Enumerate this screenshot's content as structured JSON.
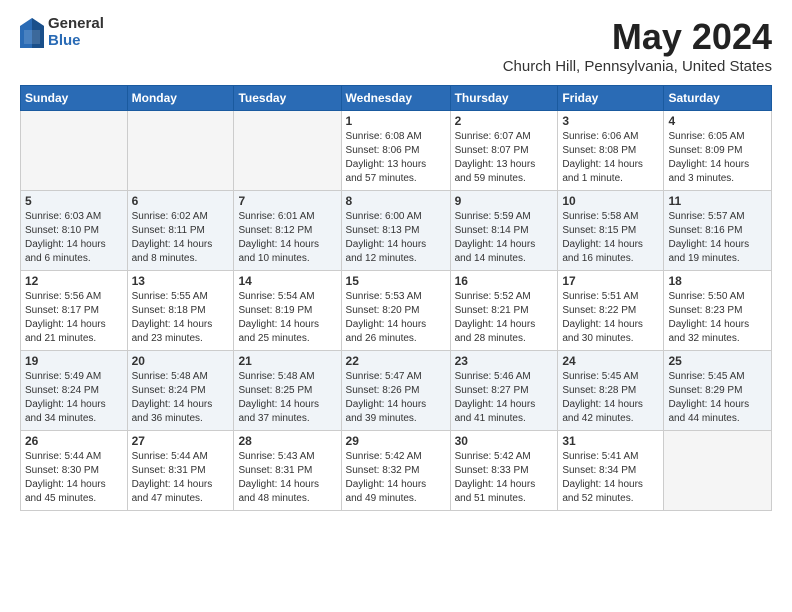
{
  "logo": {
    "general": "General",
    "blue": "Blue",
    "icon_title": "GeneralBlue logo"
  },
  "title": "May 2024",
  "location": "Church Hill, Pennsylvania, United States",
  "days_of_week": [
    "Sunday",
    "Monday",
    "Tuesday",
    "Wednesday",
    "Thursday",
    "Friday",
    "Saturday"
  ],
  "weeks": [
    [
      {
        "day": "",
        "empty": true
      },
      {
        "day": "",
        "empty": true
      },
      {
        "day": "",
        "empty": true
      },
      {
        "day": "1",
        "sunrise": "6:08 AM",
        "sunset": "8:06 PM",
        "daylight": "13 hours and 57 minutes."
      },
      {
        "day": "2",
        "sunrise": "6:07 AM",
        "sunset": "8:07 PM",
        "daylight": "13 hours and 59 minutes."
      },
      {
        "day": "3",
        "sunrise": "6:06 AM",
        "sunset": "8:08 PM",
        "daylight": "14 hours and 1 minute."
      },
      {
        "day": "4",
        "sunrise": "6:05 AM",
        "sunset": "8:09 PM",
        "daylight": "14 hours and 3 minutes."
      }
    ],
    [
      {
        "day": "5",
        "sunrise": "6:03 AM",
        "sunset": "8:10 PM",
        "daylight": "14 hours and 6 minutes."
      },
      {
        "day": "6",
        "sunrise": "6:02 AM",
        "sunset": "8:11 PM",
        "daylight": "14 hours and 8 minutes."
      },
      {
        "day": "7",
        "sunrise": "6:01 AM",
        "sunset": "8:12 PM",
        "daylight": "14 hours and 10 minutes."
      },
      {
        "day": "8",
        "sunrise": "6:00 AM",
        "sunset": "8:13 PM",
        "daylight": "14 hours and 12 minutes."
      },
      {
        "day": "9",
        "sunrise": "5:59 AM",
        "sunset": "8:14 PM",
        "daylight": "14 hours and 14 minutes."
      },
      {
        "day": "10",
        "sunrise": "5:58 AM",
        "sunset": "8:15 PM",
        "daylight": "14 hours and 16 minutes."
      },
      {
        "day": "11",
        "sunrise": "5:57 AM",
        "sunset": "8:16 PM",
        "daylight": "14 hours and 19 minutes."
      }
    ],
    [
      {
        "day": "12",
        "sunrise": "5:56 AM",
        "sunset": "8:17 PM",
        "daylight": "14 hours and 21 minutes."
      },
      {
        "day": "13",
        "sunrise": "5:55 AM",
        "sunset": "8:18 PM",
        "daylight": "14 hours and 23 minutes."
      },
      {
        "day": "14",
        "sunrise": "5:54 AM",
        "sunset": "8:19 PM",
        "daylight": "14 hours and 25 minutes."
      },
      {
        "day": "15",
        "sunrise": "5:53 AM",
        "sunset": "8:20 PM",
        "daylight": "14 hours and 26 minutes."
      },
      {
        "day": "16",
        "sunrise": "5:52 AM",
        "sunset": "8:21 PM",
        "daylight": "14 hours and 28 minutes."
      },
      {
        "day": "17",
        "sunrise": "5:51 AM",
        "sunset": "8:22 PM",
        "daylight": "14 hours and 30 minutes."
      },
      {
        "day": "18",
        "sunrise": "5:50 AM",
        "sunset": "8:23 PM",
        "daylight": "14 hours and 32 minutes."
      }
    ],
    [
      {
        "day": "19",
        "sunrise": "5:49 AM",
        "sunset": "8:24 PM",
        "daylight": "14 hours and 34 minutes."
      },
      {
        "day": "20",
        "sunrise": "5:48 AM",
        "sunset": "8:24 PM",
        "daylight": "14 hours and 36 minutes."
      },
      {
        "day": "21",
        "sunrise": "5:48 AM",
        "sunset": "8:25 PM",
        "daylight": "14 hours and 37 minutes."
      },
      {
        "day": "22",
        "sunrise": "5:47 AM",
        "sunset": "8:26 PM",
        "daylight": "14 hours and 39 minutes."
      },
      {
        "day": "23",
        "sunrise": "5:46 AM",
        "sunset": "8:27 PM",
        "daylight": "14 hours and 41 minutes."
      },
      {
        "day": "24",
        "sunrise": "5:45 AM",
        "sunset": "8:28 PM",
        "daylight": "14 hours and 42 minutes."
      },
      {
        "day": "25",
        "sunrise": "5:45 AM",
        "sunset": "8:29 PM",
        "daylight": "14 hours and 44 minutes."
      }
    ],
    [
      {
        "day": "26",
        "sunrise": "5:44 AM",
        "sunset": "8:30 PM",
        "daylight": "14 hours and 45 minutes."
      },
      {
        "day": "27",
        "sunrise": "5:44 AM",
        "sunset": "8:31 PM",
        "daylight": "14 hours and 47 minutes."
      },
      {
        "day": "28",
        "sunrise": "5:43 AM",
        "sunset": "8:31 PM",
        "daylight": "14 hours and 48 minutes."
      },
      {
        "day": "29",
        "sunrise": "5:42 AM",
        "sunset": "8:32 PM",
        "daylight": "14 hours and 49 minutes."
      },
      {
        "day": "30",
        "sunrise": "5:42 AM",
        "sunset": "8:33 PM",
        "daylight": "14 hours and 51 minutes."
      },
      {
        "day": "31",
        "sunrise": "5:41 AM",
        "sunset": "8:34 PM",
        "daylight": "14 hours and 52 minutes."
      },
      {
        "day": "",
        "empty": true
      }
    ]
  ],
  "labels": {
    "sunrise": "Sunrise:",
    "sunset": "Sunset:",
    "daylight": "Daylight:"
  }
}
